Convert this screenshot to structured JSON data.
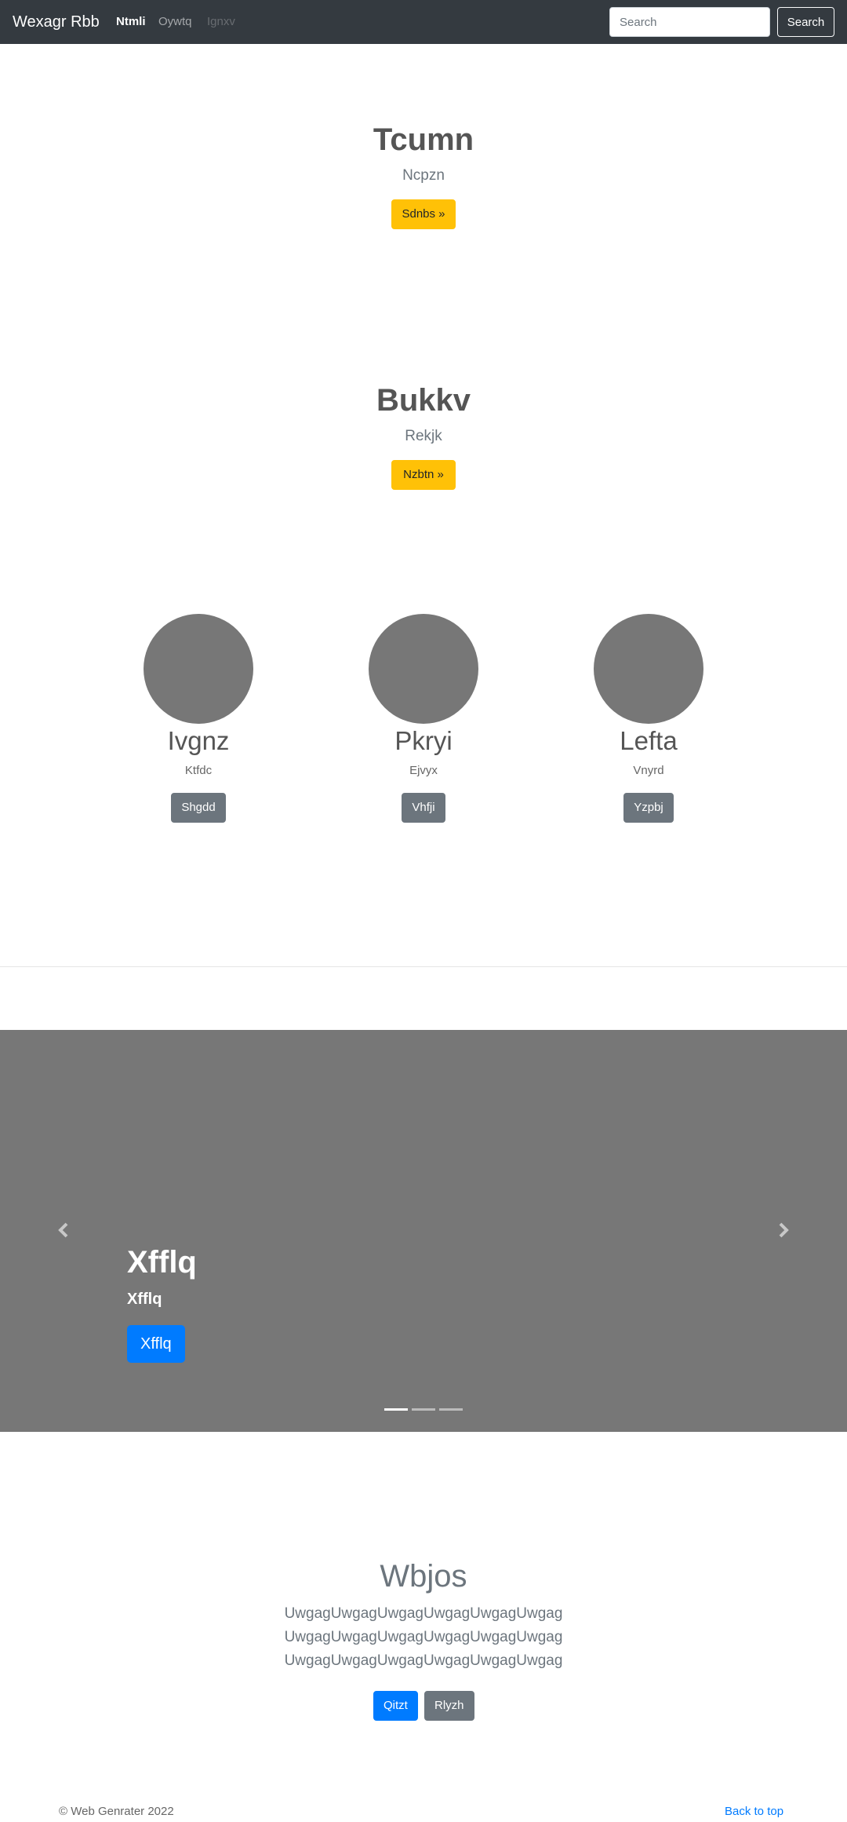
{
  "navbar": {
    "brand": "Wexagr Rbb",
    "links": [
      "Ntmli",
      "Oywtq",
      "Ignxv"
    ],
    "search_placeholder": "Search",
    "search_button": "Search"
  },
  "hero1": {
    "title": "Tcumn",
    "subtitle": "Ncpzn",
    "button": "Sdnbs »"
  },
  "hero2": {
    "title": "Bukkv",
    "subtitle": "Rekjk",
    "button": "Nzbtn »"
  },
  "columns": [
    {
      "title": "Ivgnz",
      "text": "Ktfdc",
      "button": "Shgdd"
    },
    {
      "title": "Pkryi",
      "text": "Ejvyx",
      "button": "Vhfji"
    },
    {
      "title": "Lefta",
      "text": "Vnyrd",
      "button": "Yzpbj"
    }
  ],
  "carousel": {
    "prev_icon": "chevron-left",
    "next_icon": "chevron-right",
    "caption_title": "Xfflq",
    "caption_text": "Xfflq",
    "caption_button": "Xfflq",
    "active_slide": 1,
    "slide_count": 3
  },
  "section": {
    "title": "Wbjos",
    "lines": [
      "UwgagUwgagUwgagUwgagUwgagUwgag",
      "UwgagUwgagUwgagUwgagUwgagUwgag",
      "UwgagUwgagUwgagUwgagUwgagUwgag"
    ],
    "primary_button": "Qitzt",
    "secondary_button": "Rlyzh"
  },
  "footer": {
    "copyright": "© Web Genrater 2022",
    "back_to_top": "Back to top"
  },
  "colors": {
    "navbar": "#343a40",
    "warning": "#ffc107",
    "primary": "#007bff",
    "secondary": "#6c757d",
    "placeholder": "#777777"
  }
}
